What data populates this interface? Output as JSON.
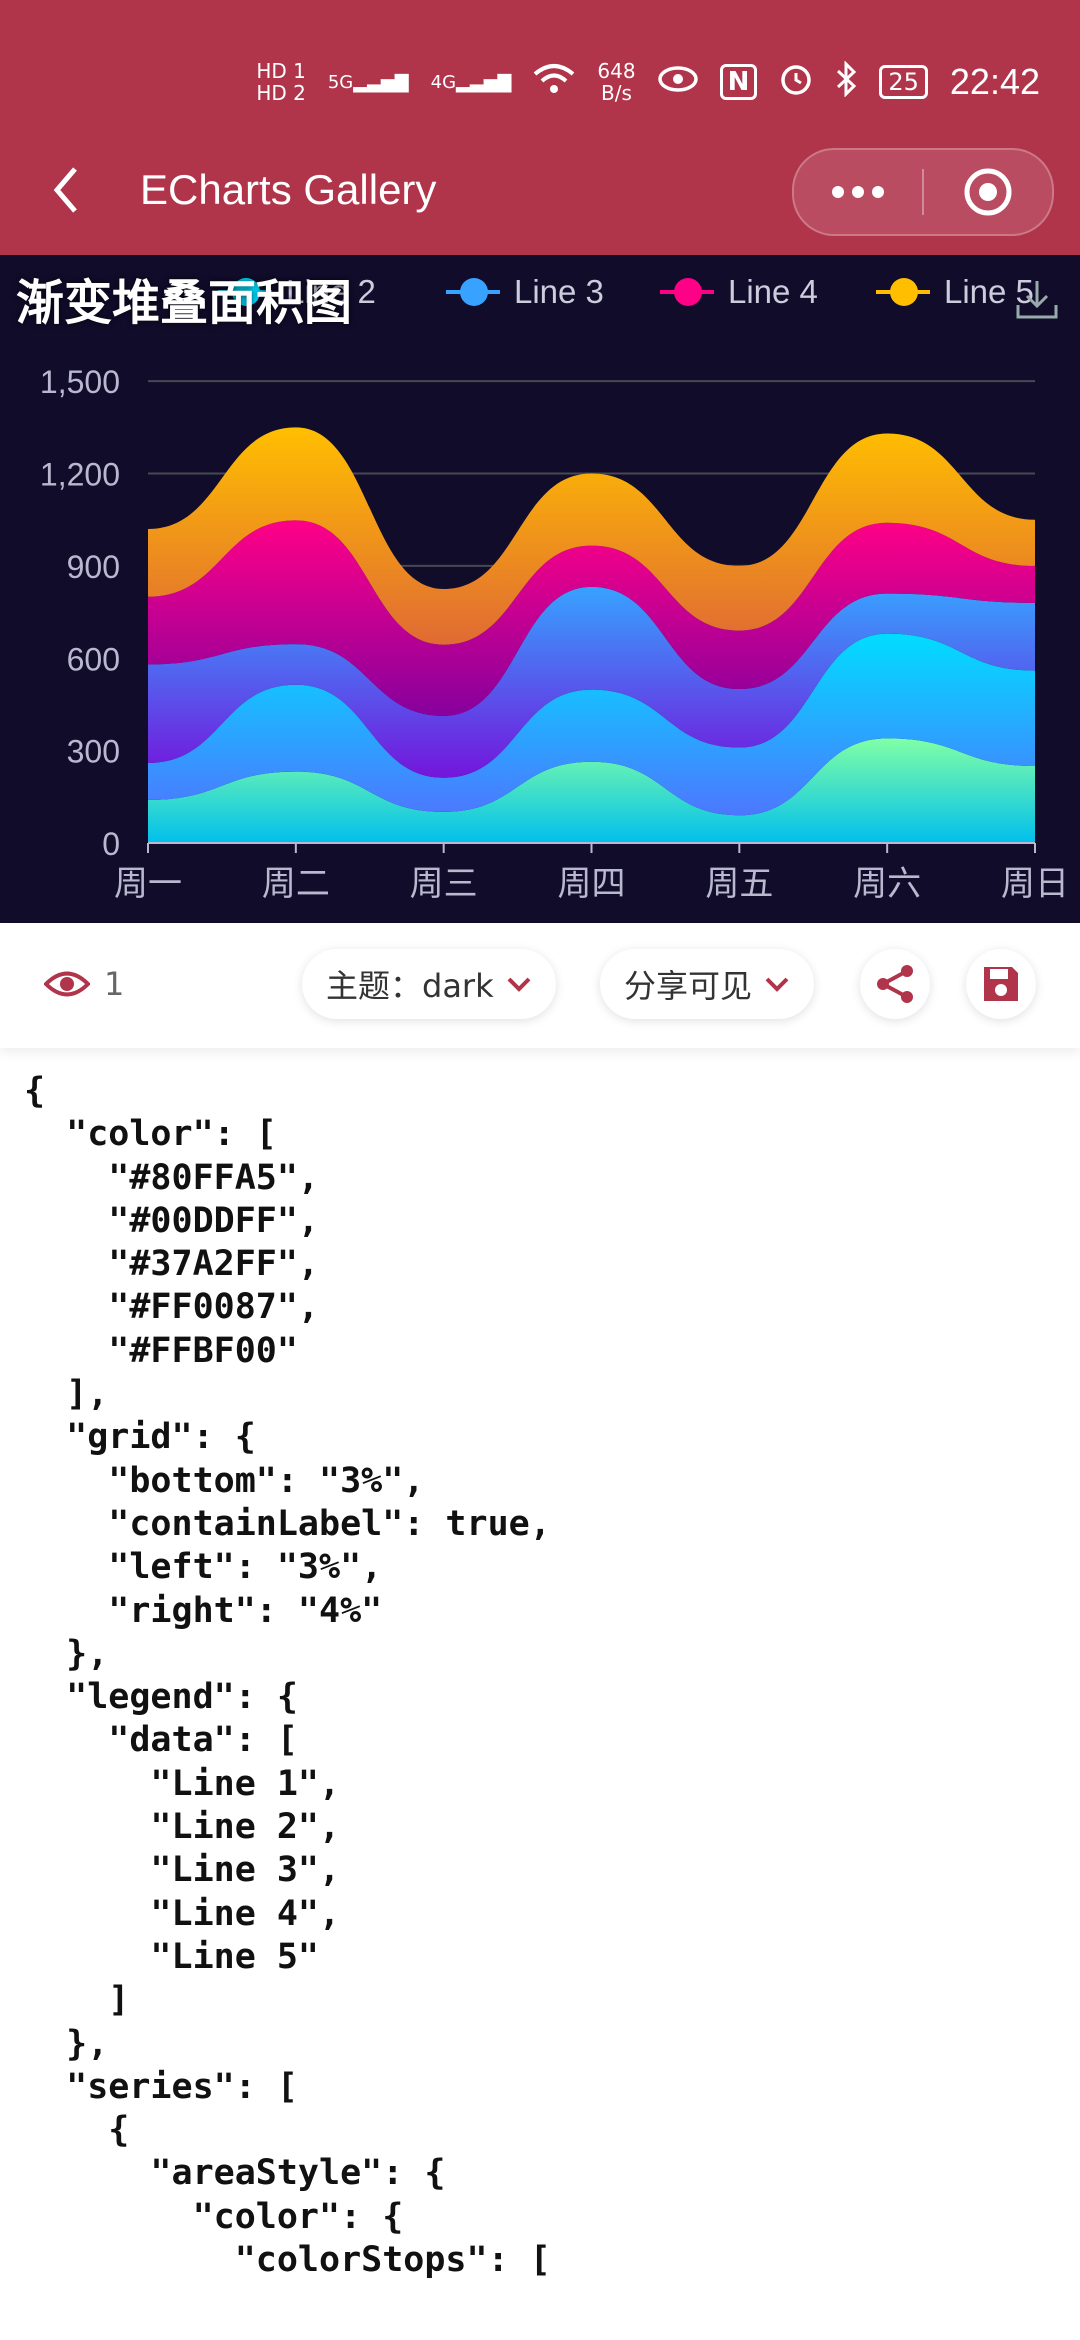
{
  "status_bar": {
    "hd1": "HD 1",
    "hd2": "HD 2",
    "net1": "5G",
    "net2": "4G",
    "speed_value": "648",
    "speed_unit": "B/s",
    "nfc": "N",
    "battery": "25",
    "time": "22:42"
  },
  "header": {
    "title": "ECharts Gallery"
  },
  "chart_data": {
    "type": "area",
    "title": "渐变堆叠面积图",
    "categories": [
      "周一",
      "周二",
      "周三",
      "周四",
      "周五",
      "周六",
      "周日"
    ],
    "ylim": [
      0,
      1650
    ],
    "yticks": [
      "0",
      "300",
      "600",
      "900",
      "1,200",
      "1,500"
    ],
    "stacked": true,
    "series": [
      {
        "name": "Line 1",
        "values": [
          140,
          232,
          101,
          264,
          90,
          340,
          250
        ],
        "color": "#80FFA5",
        "color_to": "#01BFEC"
      },
      {
        "name": "Line 2",
        "values": [
          120,
          282,
          111,
          234,
          220,
          340,
          310
        ],
        "color": "#00DDFF",
        "color_to": "#4D77FF"
      },
      {
        "name": "Line 3",
        "values": [
          320,
          132,
          201,
          334,
          190,
          130,
          220
        ],
        "color": "#37A2FF",
        "color_to": "#7415DB"
      },
      {
        "name": "Line 4",
        "values": [
          220,
          402,
          231,
          134,
          190,
          230,
          120
        ],
        "color": "#FF0087",
        "color_to": "#87009D"
      },
      {
        "name": "Line 5",
        "values": [
          220,
          302,
          181,
          234,
          210,
          290,
          150
        ],
        "color": "#FFBF00",
        "color_to": "#E06A34"
      }
    ]
  },
  "legend": {
    "visible_items": [
      {
        "label": "Line 2",
        "color": "#00DDFF"
      },
      {
        "label": "Line 3",
        "color": "#37A2FF"
      },
      {
        "label": "Line 4",
        "color": "#FF0087"
      },
      {
        "label": "Line 5",
        "color": "#FFBF00"
      }
    ]
  },
  "toolbar": {
    "views_count": "1",
    "theme_label": "主题：dark",
    "share_label": "分享可见"
  },
  "code": {
    "text": "{\n  \"color\": [\n    \"#80FFA5\",\n    \"#00DDFF\",\n    \"#37A2FF\",\n    \"#FF0087\",\n    \"#FFBF00\"\n  ],\n  \"grid\": {\n    \"bottom\": \"3%\",\n    \"containLabel\": true,\n    \"left\": \"3%\",\n    \"right\": \"4%\"\n  },\n  \"legend\": {\n    \"data\": [\n      \"Line 1\",\n      \"Line 2\",\n      \"Line 3\",\n      \"Line 4\",\n      \"Line 5\"\n    ]\n  },\n  \"series\": [\n    {\n      \"areaStyle\": {\n        \"color\": {\n          \"colorStops\": ["
  }
}
